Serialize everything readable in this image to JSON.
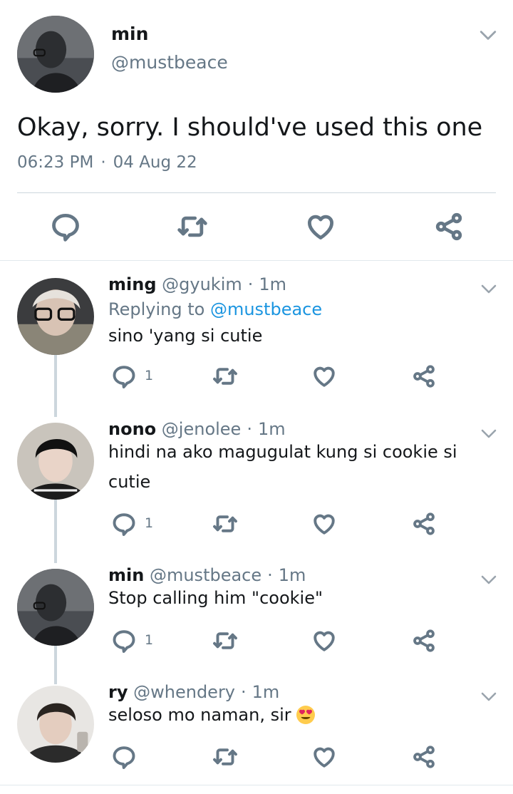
{
  "main_tweet": {
    "name": "min",
    "handle": "@mustbeace",
    "text": "Okay, sorry. I should've used this one",
    "time": "06:23 PM",
    "date": "04 Aug 22",
    "separator": "·"
  },
  "replies": [
    {
      "name": "ming",
      "handle": "@gyukim",
      "time": "1m",
      "replying_prefix": "Replying to",
      "replying_to": "@mustbeace",
      "text": "sino 'yang si cutie",
      "reply_count": "1"
    },
    {
      "name": "nono",
      "handle": "@jenolee",
      "time": "1m",
      "text_line1": "hindi na ako magugulat kung si cookie si",
      "text_line2": "cutie",
      "reply_count": "1"
    },
    {
      "name": "min",
      "handle": "@mustbeace",
      "time": "1m",
      "text": "Stop calling him \"cookie\"",
      "reply_count": "1"
    },
    {
      "name": "ry",
      "handle": "@whendery",
      "time": "1m",
      "text": "seloso mo naman, sir",
      "emoji": "heart-eyes-emoji"
    }
  ],
  "separator": "·",
  "colors": {
    "text": "#14171a",
    "secondary": "#657786",
    "link": "#1b95e0",
    "divider": "#e1e8ed",
    "thread": "#ccd6dd"
  },
  "icons": [
    "reply-icon",
    "retweet-icon",
    "like-icon",
    "share-icon",
    "chevron-down-icon"
  ]
}
